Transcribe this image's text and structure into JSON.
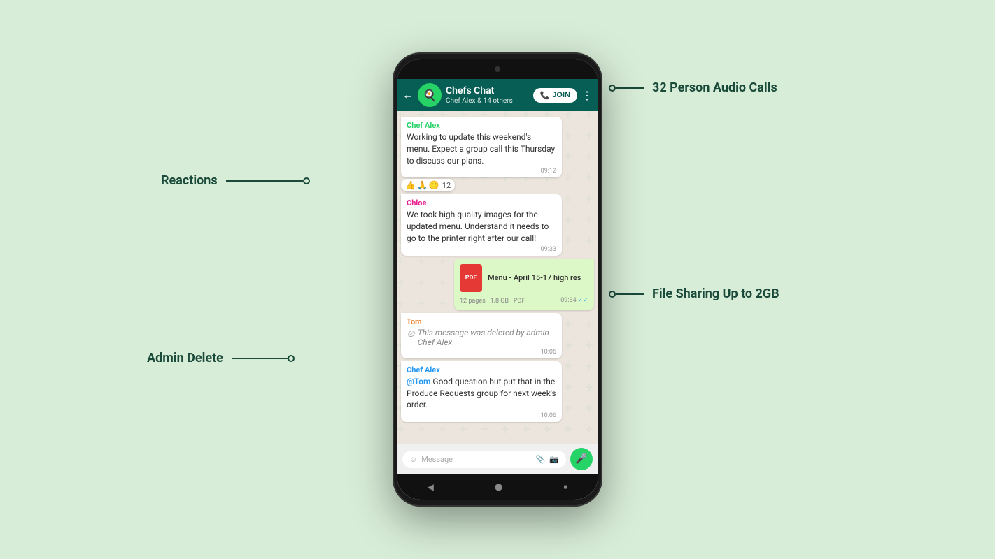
{
  "background_color": "#d8edd8",
  "annotations": {
    "reactions": {
      "label": "Reactions",
      "position": "left"
    },
    "admin_delete": {
      "label": "Admin Delete",
      "position": "left"
    },
    "audio_calls": {
      "label": "32 Person Audio Calls",
      "position": "right"
    },
    "file_sharing": {
      "label": "File Sharing Up to 2GB",
      "position": "right"
    }
  },
  "phone": {
    "header": {
      "group_name": "Chefs Chat",
      "members": "Chef Alex & 14 others",
      "join_label": "JOIN",
      "back_icon": "←",
      "menu_icon": "⋮"
    },
    "messages": [
      {
        "id": "msg1",
        "type": "received",
        "sender": "Chef Alex",
        "sender_color": "green",
        "text": "Working to update this weekend's menu. Expect a group call this Thursday to discuss our plans.",
        "time": "09:12",
        "reactions": [
          "👍",
          "🙏",
          "🙂",
          "12"
        ]
      },
      {
        "id": "msg2",
        "type": "received",
        "sender": "Chloe",
        "sender_color": "pink",
        "text": "We took high quality images for the updated menu. Understand it needs to go to the printer right after our call!",
        "time": "09:33"
      },
      {
        "id": "msg3",
        "type": "sent",
        "sender": null,
        "file_type": "pdf",
        "file_icon": "PDF",
        "file_name": "Menu - April 15-17 high res",
        "file_meta": "12 pages · 1.8 GB · PDF",
        "time": "09:34",
        "ticks": true
      },
      {
        "id": "msg4",
        "type": "received",
        "sender": "Tom",
        "sender_color": "orange",
        "deleted": true,
        "deleted_text": "This message was deleted by admin Chef Alex",
        "time": "10:06"
      },
      {
        "id": "msg5",
        "type": "received",
        "sender": "Chef Alex",
        "sender_color": "blue",
        "reply_to": "@Tom",
        "text": " Good question but put that in the Produce Requests group for next week's order.",
        "time": "10:06"
      }
    ],
    "input": {
      "placeholder": "Message",
      "emoji_icon": "☺",
      "attach_icon": "📎",
      "camera_icon": "📷",
      "mic_icon": "🎤"
    },
    "bottom_nav": {
      "back": "◀",
      "home": "⬤",
      "square": "■"
    }
  }
}
